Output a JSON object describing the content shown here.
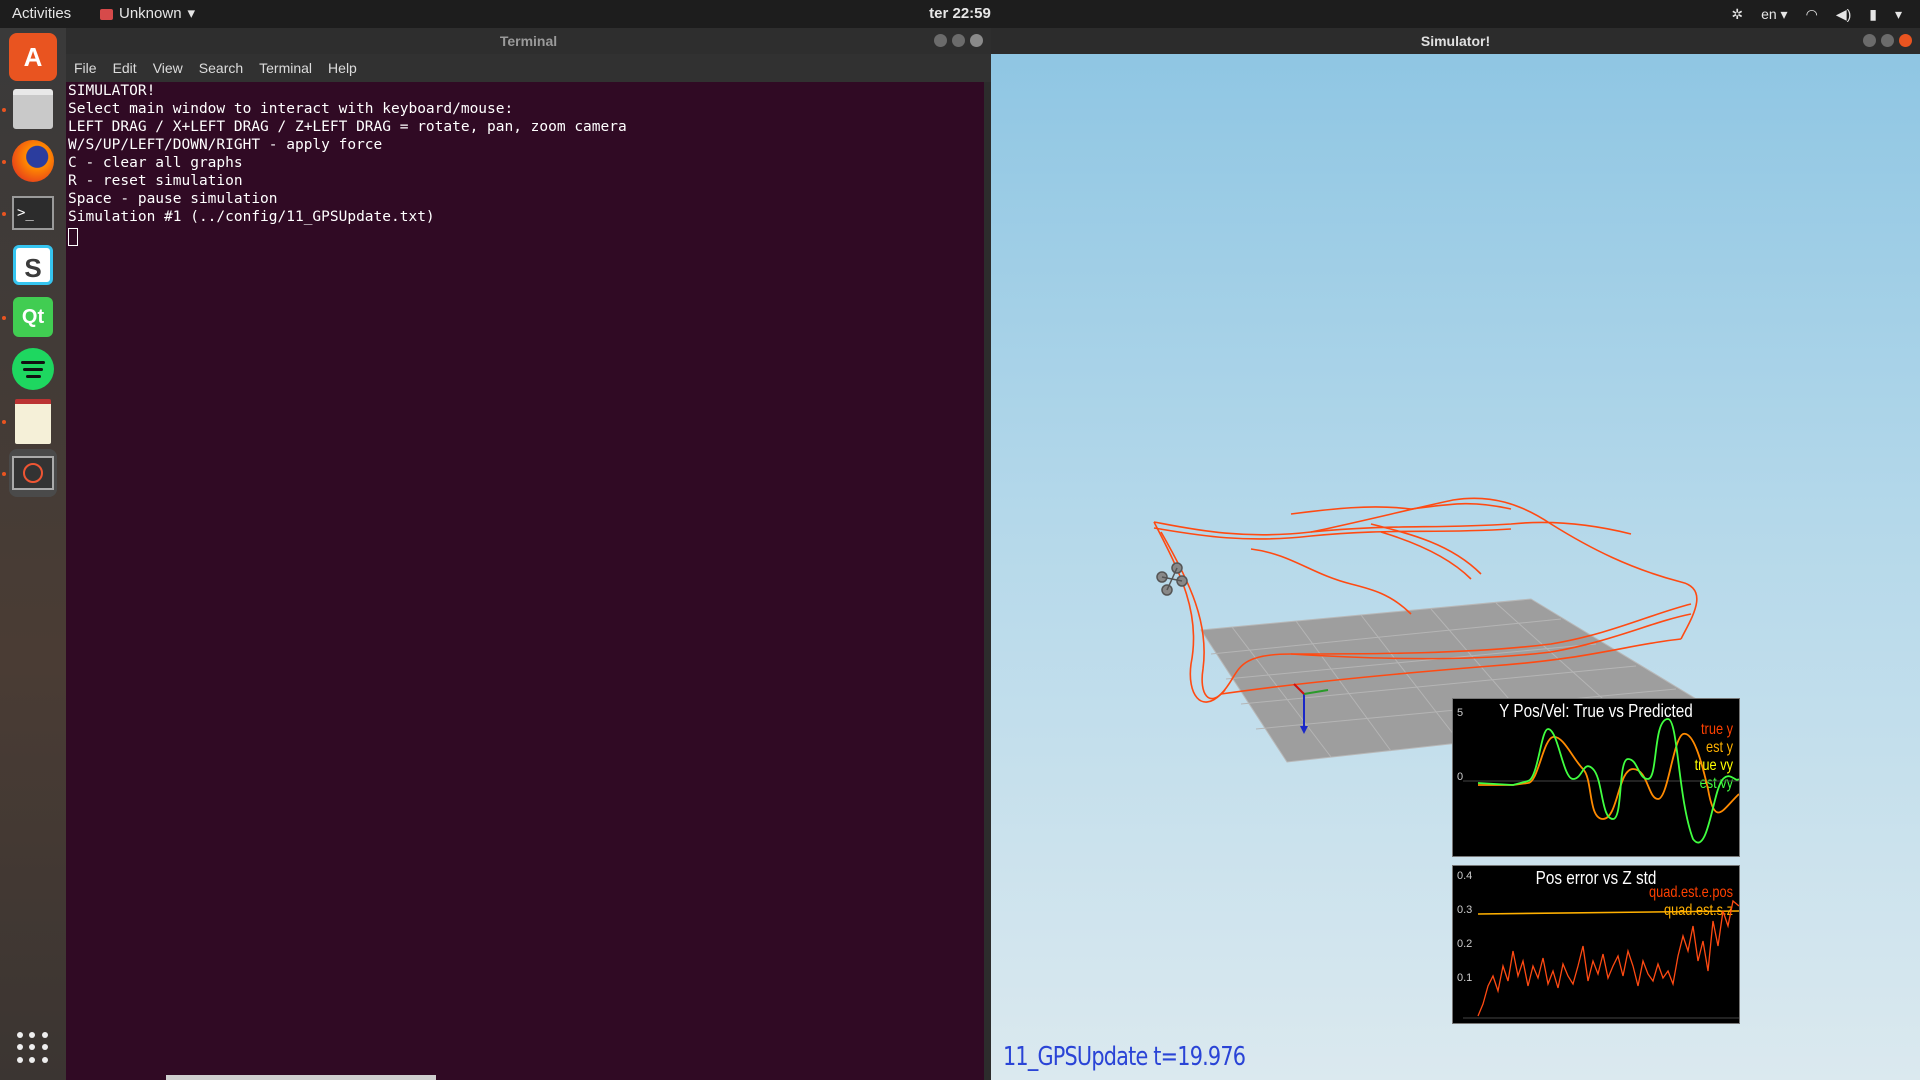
{
  "topbar": {
    "activities": "Activities",
    "app_menu": "Unknown",
    "clock": "ter 22:59",
    "lang": "en"
  },
  "dock": {
    "items": [
      "ubuntu-software-icon",
      "files-icon",
      "firefox-icon",
      "terminal-icon",
      "slack-icon",
      "qt-creator-icon",
      "spotify-icon",
      "text-editor-icon",
      "simulator-icon"
    ]
  },
  "terminal": {
    "title": "Terminal",
    "menu": [
      "File",
      "Edit",
      "View",
      "Search",
      "Terminal",
      "Help"
    ],
    "lines": [
      "SIMULATOR!",
      "Select main window to interact with keyboard/mouse:",
      "LEFT DRAG / X+LEFT DRAG / Z+LEFT DRAG = rotate, pan, zoom camera",
      "W/S/UP/LEFT/DOWN/RIGHT - apply force",
      "C - clear all graphs",
      "R - reset simulation",
      "Space - pause simulation",
      "Simulation #1 (../config/11_GPSUpdate.txt)"
    ]
  },
  "simulator": {
    "title": "Simulator!",
    "status": "11_GPSUpdate  t=19.976",
    "graph1": {
      "title": "Y Pos/Vel: True vs Predicted",
      "ticks": [
        "5",
        "0"
      ],
      "legend": [
        "true y",
        "est y",
        "true vy",
        "est vy"
      ],
      "colors": [
        "#ff4000",
        "#ffb000",
        "#ffff00",
        "#40ff40"
      ]
    },
    "graph2": {
      "title": "Pos error vs Z std",
      "ticks": [
        "0.4",
        "0.3",
        "0.2",
        "0.1"
      ],
      "legend": [
        "quad.est.e.pos",
        "quad.est.s.z"
      ],
      "colors": [
        "#ff4000",
        "#ffb000"
      ]
    }
  }
}
